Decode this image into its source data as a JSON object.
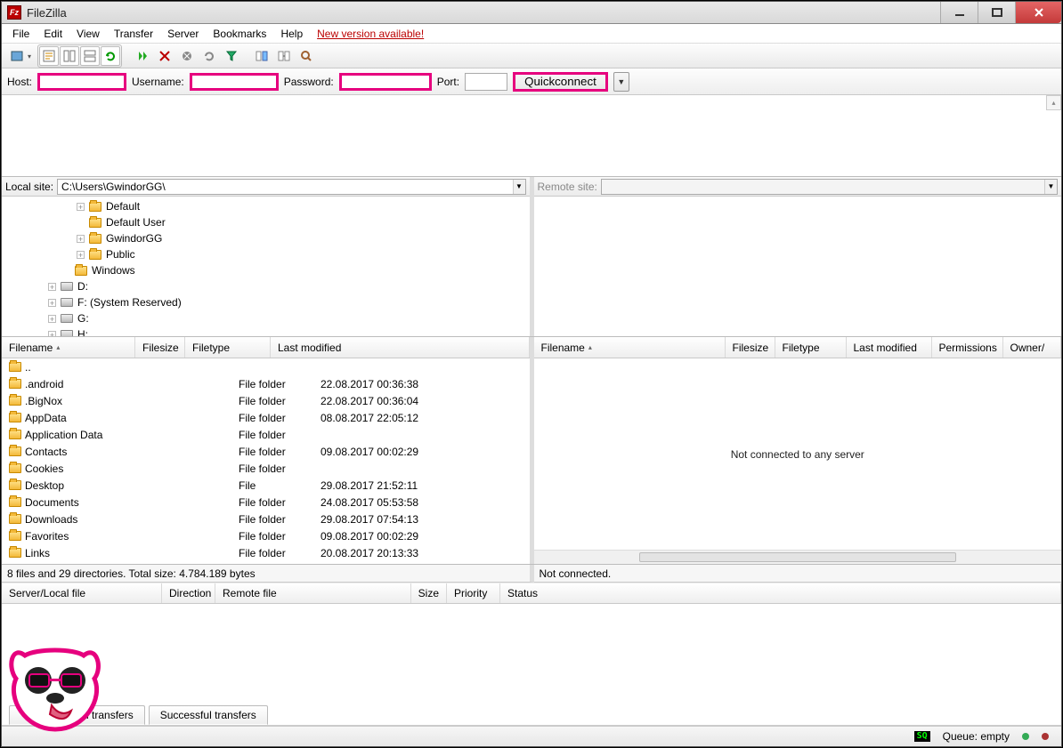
{
  "titlebar": {
    "title": "FileZilla"
  },
  "menu": [
    "File",
    "Edit",
    "View",
    "Transfer",
    "Server",
    "Bookmarks",
    "Help",
    "New version available!"
  ],
  "quick": {
    "host_label": "Host:",
    "user_label": "Username:",
    "pass_label": "Password:",
    "port_label": "Port:",
    "button": "Quickconnect",
    "host": "",
    "user": "",
    "pass": "",
    "port": ""
  },
  "local": {
    "path_label": "Local site:",
    "path": "C:\\Users\\GwindorGG\\",
    "tree": [
      {
        "indent": 5,
        "tw": "+",
        "icon": "folder",
        "label": "Default"
      },
      {
        "indent": 5,
        "tw": "",
        "icon": "folder",
        "label": "Default User"
      },
      {
        "indent": 5,
        "tw": "+",
        "icon": "folder",
        "label": "GwindorGG"
      },
      {
        "indent": 5,
        "tw": "+",
        "icon": "folder",
        "label": "Public"
      },
      {
        "indent": 4,
        "tw": "",
        "icon": "folder",
        "label": "Windows"
      },
      {
        "indent": 3,
        "tw": "+",
        "icon": "drive",
        "label": "D:"
      },
      {
        "indent": 3,
        "tw": "+",
        "icon": "drive",
        "label": "F: (System Reserved)"
      },
      {
        "indent": 3,
        "tw": "+",
        "icon": "drive",
        "label": "G:"
      },
      {
        "indent": 3,
        "tw": "+",
        "icon": "drive",
        "label": "H:"
      }
    ],
    "cols": [
      "Filename",
      "Filesize",
      "Filetype",
      "Last modified"
    ],
    "rows": [
      {
        "name": "..",
        "type": "",
        "mod": ""
      },
      {
        "name": ".android",
        "type": "File folder",
        "mod": "22.08.2017 00:36:38"
      },
      {
        "name": ".BigNox",
        "type": "File folder",
        "mod": "22.08.2017 00:36:04"
      },
      {
        "name": "AppData",
        "type": "File folder",
        "mod": "08.08.2017 22:05:12"
      },
      {
        "name": "Application Data",
        "type": "File folder",
        "mod": ""
      },
      {
        "name": "Contacts",
        "type": "File folder",
        "mod": "09.08.2017 00:02:29"
      },
      {
        "name": "Cookies",
        "type": "File folder",
        "mod": ""
      },
      {
        "name": "Desktop",
        "type": "File",
        "mod": "29.08.2017 21:52:11"
      },
      {
        "name": "Documents",
        "type": "File folder",
        "mod": "24.08.2017 05:53:58"
      },
      {
        "name": "Downloads",
        "type": "File folder",
        "mod": "29.08.2017 07:54:13"
      },
      {
        "name": "Favorites",
        "type": "File folder",
        "mod": "09.08.2017 00:02:29"
      },
      {
        "name": "Links",
        "type": "File folder",
        "mod": "20.08.2017 20:13:33"
      }
    ],
    "status": "8 files and 29 directories. Total size: 4.784.189 bytes"
  },
  "remote": {
    "path_label": "Remote site:",
    "cols": [
      "Filename",
      "Filesize",
      "Filetype",
      "Last modified",
      "Permissions",
      "Owner/"
    ],
    "empty": "Not connected to any server",
    "status": "Not connected."
  },
  "queue": {
    "cols": [
      "Server/Local file",
      "Direction",
      "Remote file",
      "Size",
      "Priority",
      "Status"
    ]
  },
  "tabs": [
    "iled transfers",
    "Successful transfers"
  ],
  "statusbar": {
    "queue": "Queue: empty"
  }
}
